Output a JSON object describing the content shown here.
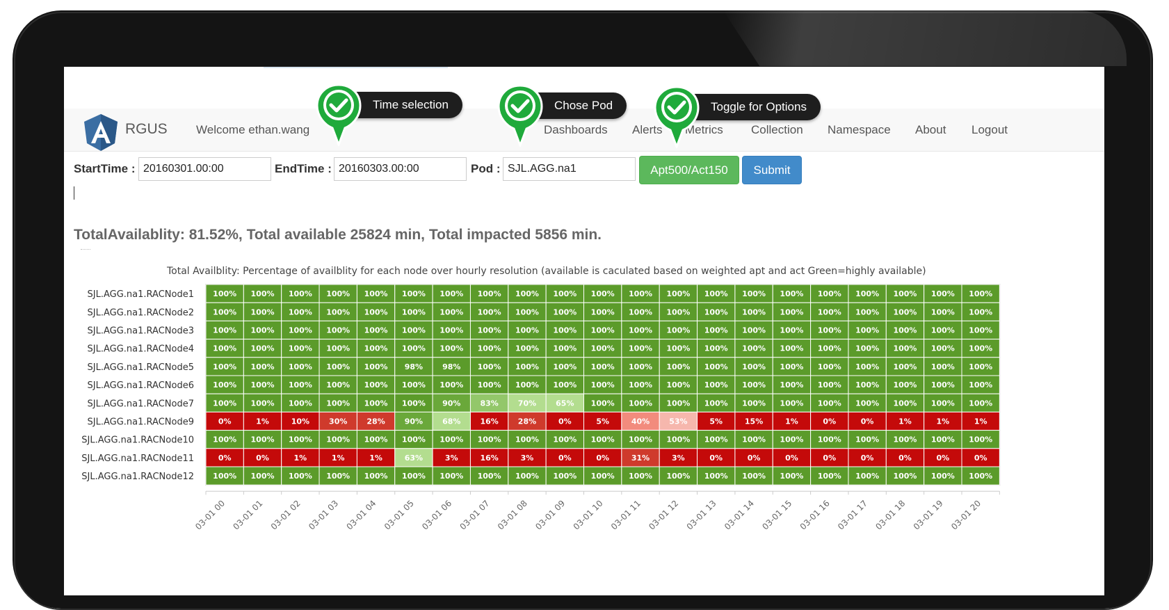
{
  "navbar": {
    "brand": "RGUS",
    "welcome": "Welcome ethan.wang",
    "items": [
      "Dashboards",
      "Alerts",
      "Metrics",
      "Collection",
      "Namespace",
      "About",
      "Logout"
    ]
  },
  "callouts": {
    "time": "Time selection",
    "pod": "Chose Pod",
    "options": "Toggle for Options"
  },
  "form": {
    "start_label": "StartTime :",
    "start_value": "20160301.00:00",
    "end_label": "EndTime :",
    "end_value": "20160303.00:00",
    "pod_label": "Pod :",
    "pod_value": "SJL.AGG.na1",
    "options_button": "Apt500/Act150",
    "submit_button": "Submit"
  },
  "summary": "TotalAvailablity: 81.52%, Total available 25824 min, Total impacted 5856 min.",
  "colors": {
    "high": "#5b9b2a",
    "high_mid": "#6aa83a",
    "mid": "#93c76a",
    "light": "#b3dd8f",
    "pink_light": "#f6b7ad",
    "pink": "#f28b7d",
    "red_mid": "#cf3a2c",
    "red": "#c40a0a",
    "brand_blue": "#3b6ea3"
  },
  "chart_data": {
    "type": "heatmap",
    "title": "Total Availblity: Percentage of availblity for each node over hourly resolution (available is caculated based on weighted apt and act Green=highly available)",
    "x": [
      "03-01 00",
      "03-01 01",
      "03-01 02",
      "03-01 03",
      "03-01 04",
      "03-01 05",
      "03-01 06",
      "03-01 07",
      "03-01 08",
      "03-01 09",
      "03-01 10",
      "03-01 11",
      "03-01 12",
      "03-01 13",
      "03-01 14",
      "03-01 15",
      "03-01 16",
      "03-01 17",
      "03-01 18",
      "03-01 19",
      "03-01 20"
    ],
    "y": [
      "SJL.AGG.na1.RACNode1",
      "SJL.AGG.na1.RACNode2",
      "SJL.AGG.na1.RACNode3",
      "SJL.AGG.na1.RACNode4",
      "SJL.AGG.na1.RACNode5",
      "SJL.AGG.na1.RACNode6",
      "SJL.AGG.na1.RACNode7",
      "SJL.AGG.na1.RACNode9",
      "SJL.AGG.na1.RACNode10",
      "SJL.AGG.na1.RACNode11",
      "SJL.AGG.na1.RACNode12"
    ],
    "values": [
      [
        100,
        100,
        100,
        100,
        100,
        100,
        100,
        100,
        100,
        100,
        100,
        100,
        100,
        100,
        100,
        100,
        100,
        100,
        100,
        100,
        100
      ],
      [
        100,
        100,
        100,
        100,
        100,
        100,
        100,
        100,
        100,
        100,
        100,
        100,
        100,
        100,
        100,
        100,
        100,
        100,
        100,
        100,
        100
      ],
      [
        100,
        100,
        100,
        100,
        100,
        100,
        100,
        100,
        100,
        100,
        100,
        100,
        100,
        100,
        100,
        100,
        100,
        100,
        100,
        100,
        100
      ],
      [
        100,
        100,
        100,
        100,
        100,
        100,
        100,
        100,
        100,
        100,
        100,
        100,
        100,
        100,
        100,
        100,
        100,
        100,
        100,
        100,
        100
      ],
      [
        100,
        100,
        100,
        100,
        100,
        98,
        98,
        100,
        100,
        100,
        100,
        100,
        100,
        100,
        100,
        100,
        100,
        100,
        100,
        100,
        100
      ],
      [
        100,
        100,
        100,
        100,
        100,
        100,
        100,
        100,
        100,
        100,
        100,
        100,
        100,
        100,
        100,
        100,
        100,
        100,
        100,
        100,
        100
      ],
      [
        100,
        100,
        100,
        100,
        100,
        100,
        90,
        83,
        70,
        65,
        100,
        100,
        100,
        100,
        100,
        100,
        100,
        100,
        100,
        100,
        100
      ],
      [
        0,
        1,
        10,
        30,
        28,
        90,
        68,
        16,
        28,
        0,
        5,
        40,
        53,
        5,
        15,
        1,
        0,
        0,
        1,
        1,
        1
      ],
      [
        100,
        100,
        100,
        100,
        100,
        100,
        100,
        100,
        100,
        100,
        100,
        100,
        100,
        100,
        100,
        100,
        100,
        100,
        100,
        100,
        100
      ],
      [
        0,
        0,
        1,
        1,
        1,
        63,
        3,
        16,
        3,
        0,
        0,
        31,
        3,
        0,
        0,
        0,
        0,
        0,
        0,
        0,
        0
      ],
      [
        100,
        100,
        100,
        100,
        100,
        100,
        100,
        100,
        100,
        100,
        100,
        100,
        100,
        100,
        100,
        100,
        100,
        100,
        100,
        100,
        100
      ]
    ],
    "unit": "%"
  }
}
